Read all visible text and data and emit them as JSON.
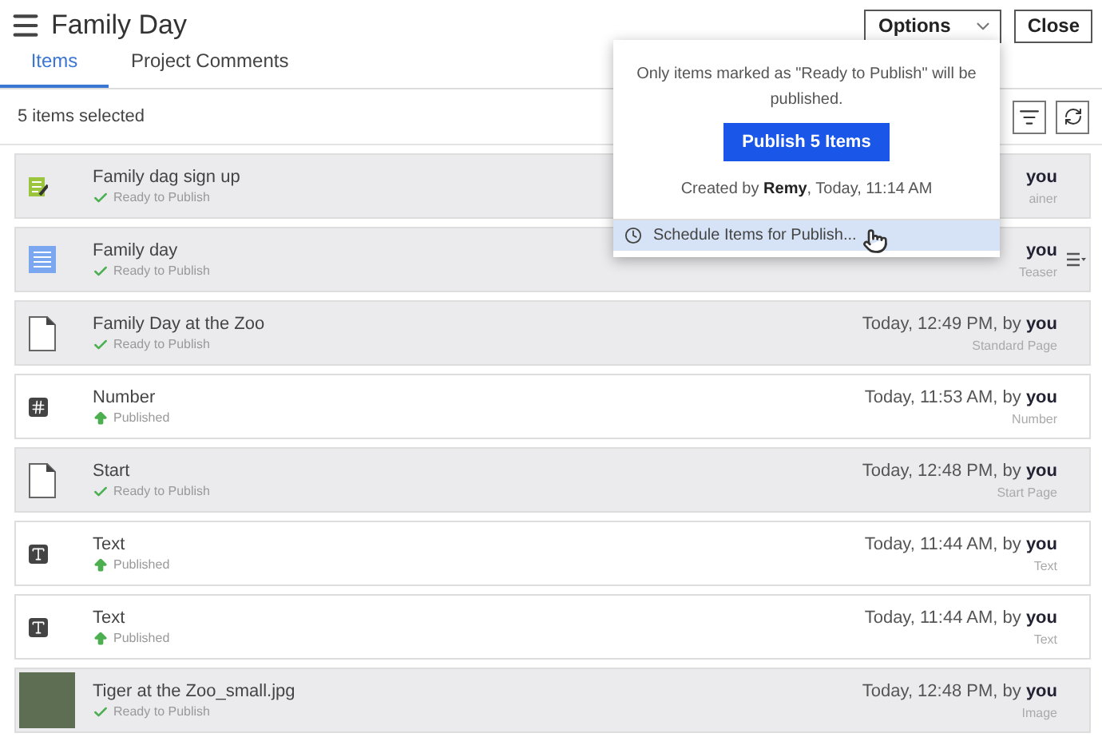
{
  "header": {
    "title": "Family Day",
    "buttons": [
      {
        "label": "Options",
        "kind": "dropdown"
      },
      {
        "label": "Close",
        "kind": "plain"
      }
    ]
  },
  "tabs": [
    {
      "label": "Items",
      "selected": true
    },
    {
      "label": "Project Comments",
      "selected": false
    }
  ],
  "toolbar": {
    "selection_count": "5 items selected"
  },
  "items": [
    {
      "name": "Family dag sign up",
      "kind": "form",
      "status": {
        "kind": "ready",
        "label": "Ready to Publish"
      },
      "modified": "**you**",
      "type": "ainer",
      "selected": true,
      "show_menu": false
    },
    {
      "name": "Family day",
      "kind": "block",
      "status": {
        "kind": "ready",
        "label": "Ready to Publish"
      },
      "modified": "**you**",
      "type": "Teaser",
      "selected": true,
      "show_menu": true
    },
    {
      "name": "Family Day at the Zoo",
      "kind": "page",
      "status": {
        "kind": "ready",
        "label": "Ready to Publish"
      },
      "modified": "Today, 12:49 PM, by **you**",
      "type": "Standard Page",
      "selected": true,
      "show_menu": false
    },
    {
      "name": "Number",
      "kind": "number",
      "status": {
        "kind": "published",
        "label": "Published"
      },
      "modified": "Today, 11:53 AM, by **you**",
      "type": "Number",
      "selected": false,
      "show_menu": false
    },
    {
      "name": "Start",
      "kind": "page",
      "status": {
        "kind": "ready",
        "label": "Ready to Publish"
      },
      "modified": "Today, 12:48 PM, by **you**",
      "type": "Start Page",
      "selected": true,
      "show_menu": false
    },
    {
      "name": "Text",
      "kind": "text",
      "status": {
        "kind": "published",
        "label": "Published"
      },
      "modified": "Today, 11:44 AM, by **you**",
      "type": "Text",
      "selected": false,
      "show_menu": false
    },
    {
      "name": "Text",
      "kind": "text",
      "status": {
        "kind": "published",
        "label": "Published"
      },
      "modified": "Today, 11:44 AM, by **you**",
      "type": "Text",
      "selected": false,
      "show_menu": false
    },
    {
      "name": "Tiger at the Zoo_small.jpg",
      "kind": "image",
      "status": {
        "kind": "ready",
        "label": "Ready to Publish"
      },
      "modified": "Today, 12:48 PM, by **you**",
      "type": "Image",
      "selected": true,
      "show_menu": false
    }
  ],
  "publish_popup": {
    "note": "Only items marked as \"Ready to Publish\" will be published.",
    "button": "Publish 5 Items",
    "created": "Created by **Remy**, Today, 11:14 AM",
    "menu": [
      {
        "label": "Schedule Items for Publish...",
        "selected": true
      }
    ]
  }
}
